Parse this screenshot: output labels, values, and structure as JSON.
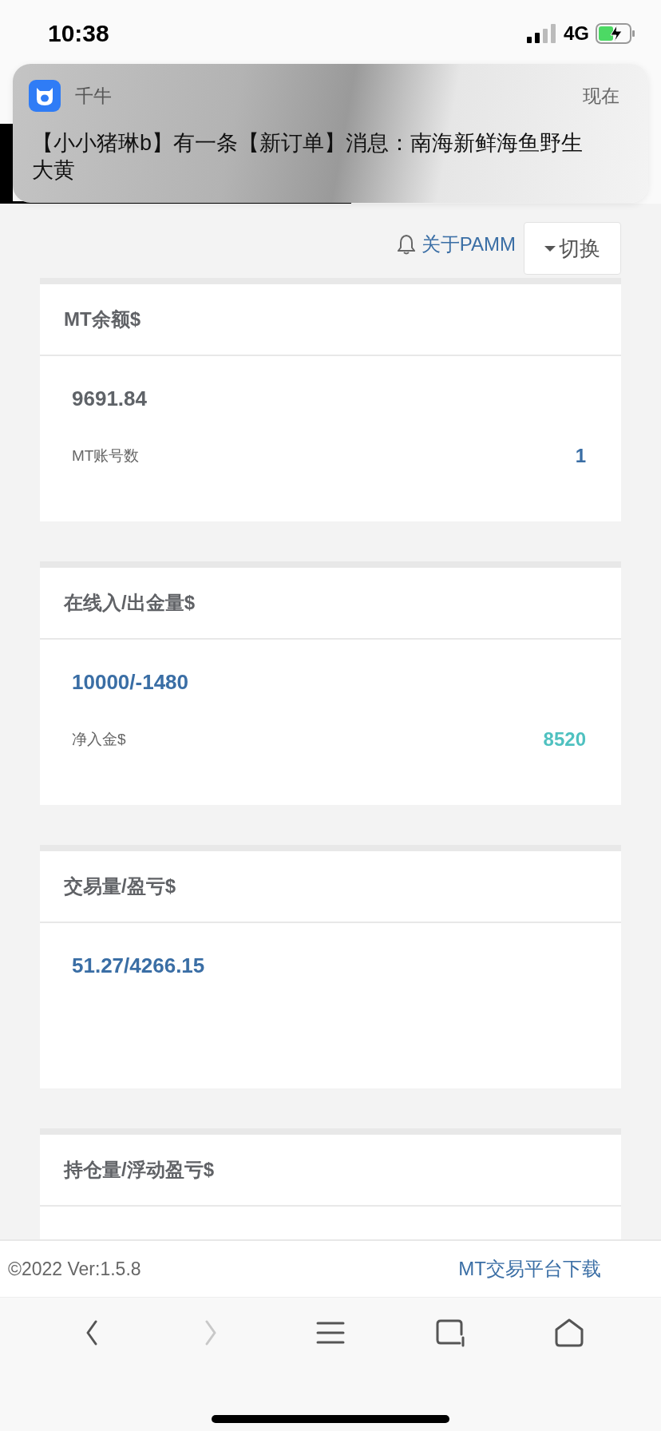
{
  "status_bar": {
    "time": "10:38",
    "network": "4G"
  },
  "notification": {
    "app": "千牛",
    "time": "现在",
    "message": "【小小猪琳b】有一条【新订单】消息：南海新鲜海鱼野生大黄"
  },
  "top_link": "关于PAMM",
  "switch_button": "切换",
  "cards": [
    {
      "title": "MT余额$",
      "value": {
        "text": "9691.84",
        "color": "#5f6368"
      },
      "stat": {
        "label": "MT账号数",
        "value": "1",
        "color": "#3a6ea5"
      }
    },
    {
      "title": "在线入/出金量$",
      "value": {
        "text": "10000/-1480",
        "color": "#3a6ea5"
      },
      "stat": {
        "label": "净入金$",
        "value": "8520",
        "color": "#4fc1c0"
      }
    },
    {
      "title": "交易量/盈亏$",
      "value": {
        "text": "51.27/4266.15",
        "color": "#3a6ea5"
      }
    },
    {
      "title": "持仓量/浮动盈亏$"
    }
  ],
  "footer": {
    "copyright": "©2022 Ver:1.5.8",
    "link": "MT交易平台下载"
  },
  "toolbar": {
    "buttons": [
      {
        "kind": "back",
        "disabled": false
      },
      {
        "kind": "forward",
        "disabled": true
      },
      {
        "kind": "menu",
        "disabled": false
      },
      {
        "kind": "tabs",
        "disabled": false
      },
      {
        "kind": "home",
        "disabled": false
      }
    ]
  }
}
